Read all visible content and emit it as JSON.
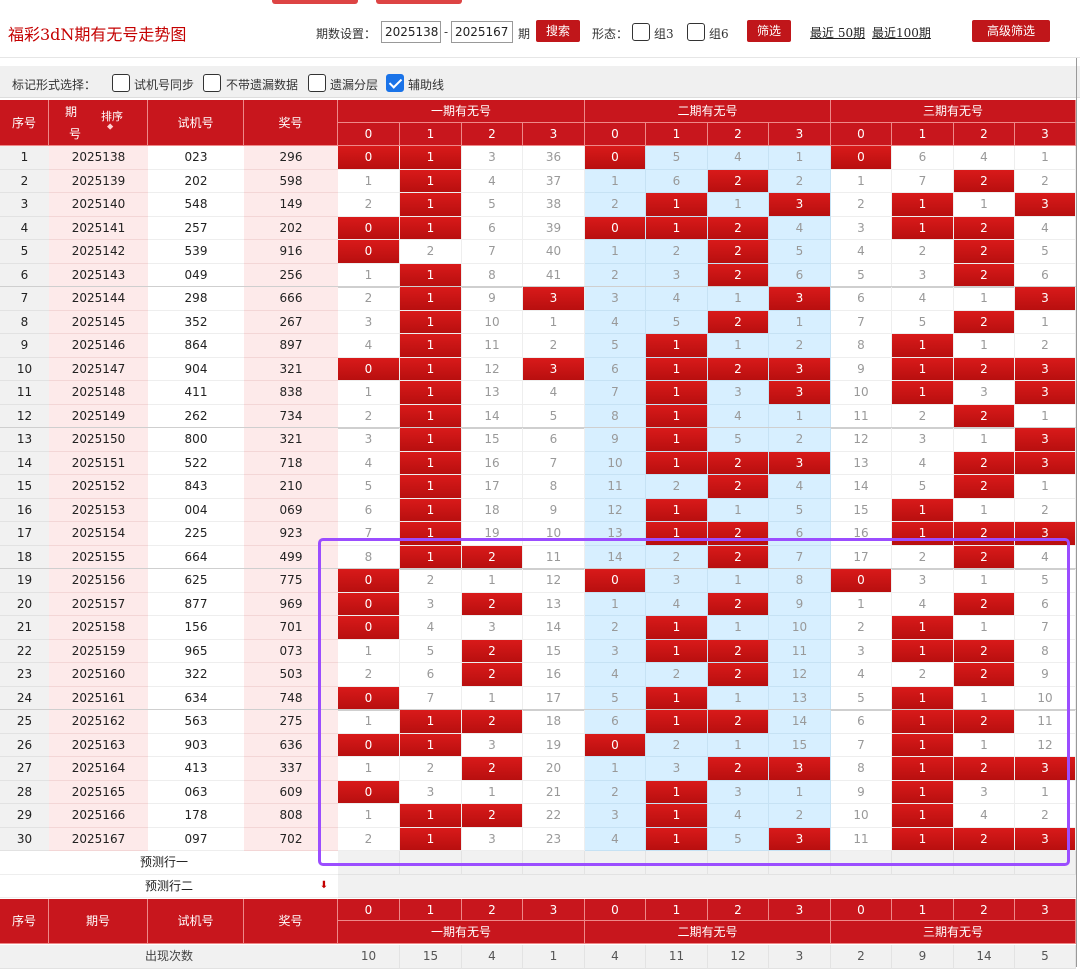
{
  "header": {
    "title": "福彩3dN期有无号走势图",
    "period_label": "期数设置：",
    "from": "2025138",
    "dash": "-",
    "to": "2025167",
    "unit": "期",
    "search": "搜索",
    "form_label": "形态：",
    "zu3": "组3",
    "zu6": "组6",
    "filter": "筛选",
    "last50": "最近 50期",
    "last100": "最近100期",
    "adv": "高级筛选"
  },
  "options": {
    "label": "标记形式选择：",
    "items": [
      {
        "text": "试机号同步",
        "checked": false
      },
      {
        "text": "不带遗漏数据",
        "checked": false
      },
      {
        "text": "遗漏分层",
        "checked": false
      },
      {
        "text": "辅助线",
        "checked": true
      }
    ]
  },
  "table": {
    "col_seq": "序号",
    "col_period_a": "期",
    "col_period_b": "号",
    "col_sort": "排序",
    "col_trial": "试机号",
    "col_prize": "奖号",
    "col_period": "期号",
    "groups": [
      "一期有无号",
      "二期有无号",
      "三期有无号"
    ],
    "sub": [
      "0",
      "1",
      "2",
      "3"
    ],
    "rows": [
      [
        "1",
        "2025138",
        "023",
        "296",
        "0",
        "1",
        "3",
        "36",
        "0",
        "5",
        "4",
        "1",
        "0",
        "6",
        "4",
        "1"
      ],
      [
        "2",
        "2025139",
        "202",
        "598",
        "1",
        "1",
        "4",
        "37",
        "1",
        "6",
        "2",
        "2",
        "1",
        "7",
        "2",
        "2"
      ],
      [
        "3",
        "2025140",
        "548",
        "149",
        "2",
        "1",
        "5",
        "38",
        "2",
        "1",
        "1",
        "3",
        "2",
        "1",
        "1",
        "3"
      ],
      [
        "4",
        "2025141",
        "257",
        "202",
        "0",
        "1",
        "6",
        "39",
        "0",
        "1",
        "2",
        "4",
        "3",
        "1",
        "2",
        "4"
      ],
      [
        "5",
        "2025142",
        "539",
        "916",
        "0",
        "2",
        "7",
        "40",
        "1",
        "2",
        "2",
        "5",
        "4",
        "2",
        "2",
        "5"
      ],
      [
        "6",
        "2025143",
        "049",
        "256",
        "1",
        "1",
        "8",
        "41",
        "2",
        "3",
        "2",
        "6",
        "5",
        "3",
        "2",
        "6"
      ],
      [
        "7",
        "2025144",
        "298",
        "666",
        "2",
        "1",
        "9",
        "3",
        "3",
        "4",
        "1",
        "3",
        "6",
        "4",
        "1",
        "3"
      ],
      [
        "8",
        "2025145",
        "352",
        "267",
        "3",
        "1",
        "10",
        "1",
        "4",
        "5",
        "2",
        "1",
        "7",
        "5",
        "2",
        "1"
      ],
      [
        "9",
        "2025146",
        "864",
        "897",
        "4",
        "1",
        "11",
        "2",
        "5",
        "1",
        "1",
        "2",
        "8",
        "1",
        "1",
        "2"
      ],
      [
        "10",
        "2025147",
        "904",
        "321",
        "0",
        "1",
        "12",
        "3",
        "6",
        "1",
        "2",
        "3",
        "9",
        "1",
        "2",
        "3"
      ],
      [
        "11",
        "2025148",
        "411",
        "838",
        "1",
        "1",
        "13",
        "4",
        "7",
        "1",
        "3",
        "3",
        "10",
        "1",
        "3",
        "3"
      ],
      [
        "12",
        "2025149",
        "262",
        "734",
        "2",
        "1",
        "14",
        "5",
        "8",
        "1",
        "4",
        "1",
        "11",
        "2",
        "2",
        "1"
      ],
      [
        "13",
        "2025150",
        "800",
        "321",
        "3",
        "1",
        "15",
        "6",
        "9",
        "1",
        "5",
        "2",
        "12",
        "3",
        "1",
        "3"
      ],
      [
        "14",
        "2025151",
        "522",
        "718",
        "4",
        "1",
        "16",
        "7",
        "10",
        "1",
        "2",
        "3",
        "13",
        "4",
        "2",
        "3"
      ],
      [
        "15",
        "2025152",
        "843",
        "210",
        "5",
        "1",
        "17",
        "8",
        "11",
        "2",
        "2",
        "4",
        "14",
        "5",
        "2",
        "1"
      ],
      [
        "16",
        "2025153",
        "004",
        "069",
        "6",
        "1",
        "18",
        "9",
        "12",
        "1",
        "1",
        "5",
        "15",
        "1",
        "1",
        "2"
      ],
      [
        "17",
        "2025154",
        "225",
        "923",
        "7",
        "1",
        "19",
        "10",
        "13",
        "1",
        "2",
        "6",
        "16",
        "1",
        "2",
        "3"
      ],
      [
        "18",
        "2025155",
        "664",
        "499",
        "8",
        "1",
        "2",
        "11",
        "14",
        "2",
        "2",
        "7",
        "17",
        "2",
        "2",
        "4"
      ],
      [
        "19",
        "2025156",
        "625",
        "775",
        "0",
        "2",
        "1",
        "12",
        "0",
        "3",
        "1",
        "8",
        "0",
        "3",
        "1",
        "5"
      ],
      [
        "20",
        "2025157",
        "877",
        "969",
        "0",
        "3",
        "2",
        "13",
        "1",
        "4",
        "2",
        "9",
        "1",
        "4",
        "2",
        "6"
      ],
      [
        "21",
        "2025158",
        "156",
        "701",
        "0",
        "4",
        "3",
        "14",
        "2",
        "1",
        "1",
        "10",
        "2",
        "1",
        "1",
        "7"
      ],
      [
        "22",
        "2025159",
        "965",
        "073",
        "1",
        "5",
        "2",
        "15",
        "3",
        "1",
        "2",
        "11",
        "3",
        "1",
        "2",
        "8"
      ],
      [
        "23",
        "2025160",
        "322",
        "503",
        "2",
        "6",
        "2",
        "16",
        "4",
        "2",
        "2",
        "12",
        "4",
        "2",
        "2",
        "9"
      ],
      [
        "24",
        "2025161",
        "634",
        "748",
        "0",
        "7",
        "1",
        "17",
        "5",
        "1",
        "1",
        "13",
        "5",
        "1",
        "1",
        "10"
      ],
      [
        "25",
        "2025162",
        "563",
        "275",
        "1",
        "1",
        "2",
        "18",
        "6",
        "1",
        "2",
        "14",
        "6",
        "1",
        "2",
        "11"
      ],
      [
        "26",
        "2025163",
        "903",
        "636",
        "0",
        "1",
        "3",
        "19",
        "0",
        "2",
        "1",
        "15",
        "7",
        "1",
        "1",
        "12"
      ],
      [
        "27",
        "2025164",
        "413",
        "337",
        "1",
        "2",
        "2",
        "20",
        "1",
        "3",
        "2",
        "3",
        "8",
        "1",
        "2",
        "3"
      ],
      [
        "28",
        "2025165",
        "063",
        "609",
        "0",
        "3",
        "1",
        "21",
        "2",
        "1",
        "3",
        "1",
        "9",
        "1",
        "3",
        "1"
      ],
      [
        "29",
        "2025166",
        "178",
        "808",
        "1",
        "1",
        "2",
        "22",
        "3",
        "1",
        "4",
        "2",
        "10",
        "1",
        "4",
        "2"
      ],
      [
        "30",
        "2025167",
        "097",
        "702",
        "2",
        "1",
        "3",
        "23",
        "4",
        "1",
        "5",
        "3",
        "11",
        "1",
        "2",
        "3"
      ]
    ],
    "predict1": "预测行一",
    "predict2": "预测行二",
    "count_label": "出现次数",
    "counts": [
      "10",
      "15",
      "4",
      "1",
      "4",
      "11",
      "12",
      "3",
      "2",
      "9",
      "14",
      "5"
    ]
  }
}
